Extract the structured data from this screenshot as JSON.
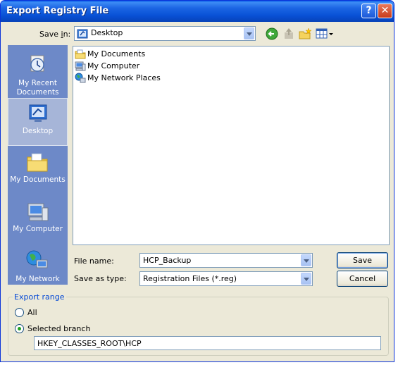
{
  "window": {
    "title": "Export Registry File"
  },
  "toolbar": {
    "save_in_label": "Save in:",
    "location": "Desktop",
    "back": "back-icon",
    "up": "up-folder-icon",
    "new_folder": "new-folder-icon",
    "views": "views-menu-icon"
  },
  "places": [
    {
      "label": "My Recent Documents",
      "icon": "recent-documents-icon"
    },
    {
      "label": "Desktop",
      "icon": "desktop-icon",
      "selected": true
    },
    {
      "label": "My Documents",
      "icon": "my-documents-icon"
    },
    {
      "label": "My Computer",
      "icon": "my-computer-icon"
    },
    {
      "label": "My Network",
      "icon": "my-network-icon"
    }
  ],
  "files": [
    {
      "name": "My Documents",
      "icon": "folder-documents-icon"
    },
    {
      "name": "My Computer",
      "icon": "computer-icon"
    },
    {
      "name": "My Network Places",
      "icon": "network-places-icon"
    }
  ],
  "form": {
    "file_name_label": "File name:",
    "file_name_value": "HCP_Backup",
    "save_as_type_label": "Save as type:",
    "save_as_type_value": "Registration Files (*.reg)"
  },
  "buttons": {
    "save": "Save",
    "cancel": "Cancel"
  },
  "export_range": {
    "legend": "Export range",
    "all_label": "All",
    "selected_branch_label": "Selected branch",
    "selected": "selected_branch",
    "branch_value": "HKEY_CLASSES_ROOT\\HCP"
  },
  "colors": {
    "title_bar": "#0a5fe8",
    "dialog_bg": "#ece9d8",
    "places_bar": "#6d89c8",
    "legend": "#0046d5"
  }
}
